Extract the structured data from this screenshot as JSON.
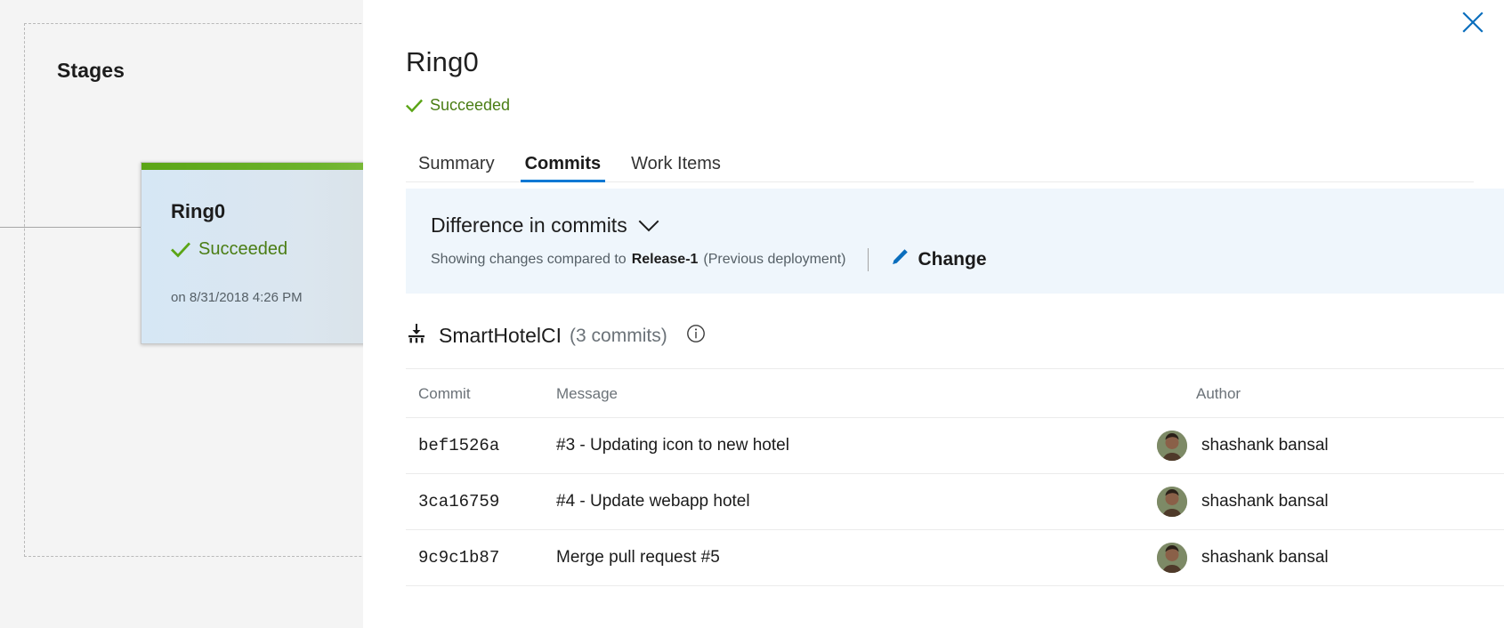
{
  "pipeline": {
    "stages_label": "Stages",
    "stage_card": {
      "name": "Ring0",
      "status": "Succeeded",
      "timestamp": "on 8/31/2018 4:26 PM",
      "status_color": "#4a7d14",
      "accent_color": "#6cb32b"
    }
  },
  "panel": {
    "close_label": "Close",
    "title": "Ring0",
    "status": "Succeeded",
    "status_color": "#4a7d14",
    "accent_color": "#0078d4",
    "tabs": [
      {
        "label": "Summary",
        "active": false
      },
      {
        "label": "Commits",
        "active": true
      },
      {
        "label": "Work Items",
        "active": false
      }
    ],
    "difference": {
      "title": "Difference in commits",
      "showing_prefix": "Showing changes compared to",
      "compared_release": "Release-1",
      "compared_suffix": "(Previous deployment)",
      "change_label": "Change",
      "background_color": "#eff6fc"
    },
    "artifact": {
      "name": "SmartHotelCI",
      "commit_count": "(3 commits)"
    },
    "table": {
      "columns": [
        "Commit",
        "Message",
        "Author"
      ],
      "rows": [
        {
          "commit": "bef1526a",
          "message": "#3 - Updating icon to new hotel",
          "author": "shashank bansal"
        },
        {
          "commit": "3ca16759",
          "message": "#4 - Update webapp hotel",
          "author": "shashank bansal"
        },
        {
          "commit": "9c9c1b87",
          "message": "Merge pull request #5",
          "author": "shashank bansal"
        }
      ]
    }
  }
}
